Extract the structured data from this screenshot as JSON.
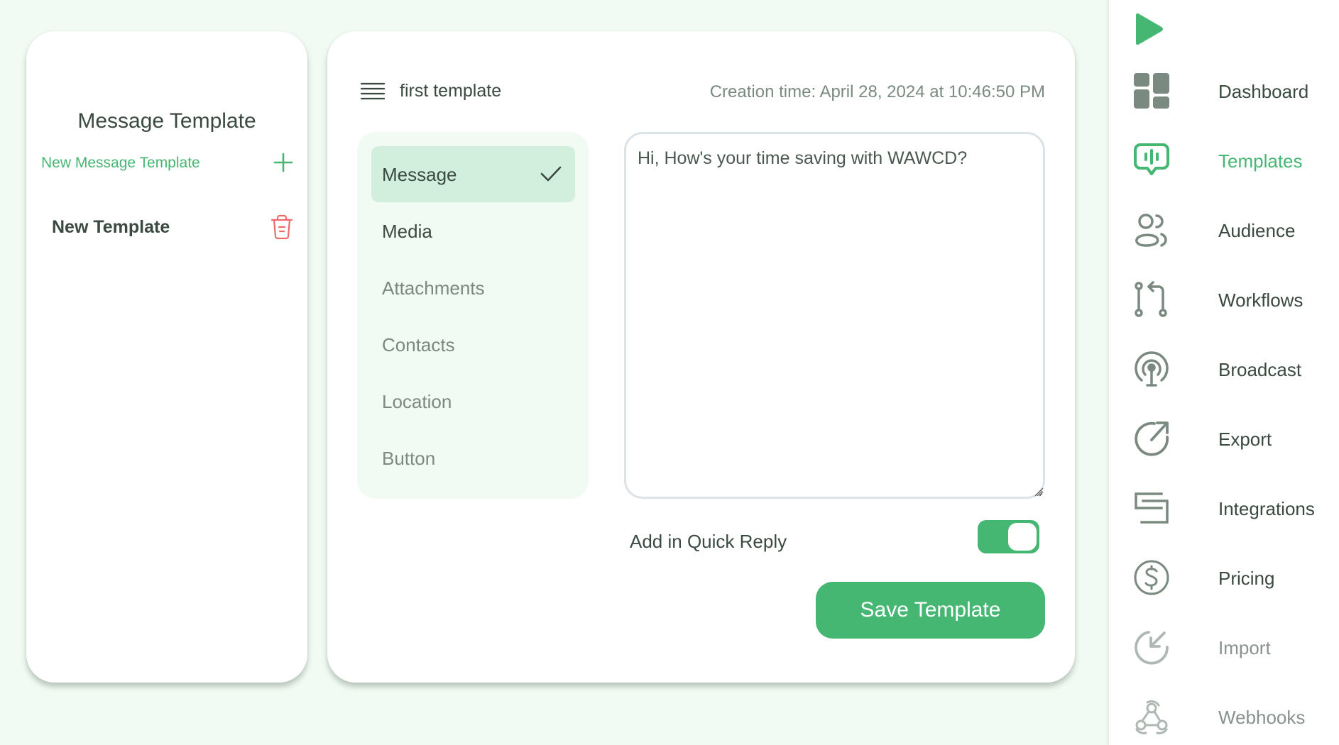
{
  "colors": {
    "accent": "#45b773",
    "background": "#f1fbf3",
    "text": "#3b4a40",
    "muted": "#7b8a80",
    "danger": "#f06a6a",
    "selected_tab": "#d2eedd",
    "icon_gray": "#7b8a80"
  },
  "left_panel": {
    "title": "Message Template",
    "new_template_label": "New Message Template",
    "templates": [
      {
        "name": "New Template"
      }
    ]
  },
  "editor": {
    "template_name": "first template",
    "creation_time": "Creation time: April 28, 2024 at 10:46:50 PM",
    "tabs": [
      {
        "label": "Message",
        "active": true
      },
      {
        "label": "Media",
        "active": false
      },
      {
        "label": "Attachments",
        "active": false
      },
      {
        "label": "Contacts",
        "active": false
      },
      {
        "label": "Location",
        "active": false
      },
      {
        "label": "Button",
        "active": false
      }
    ],
    "message_text": "Hi, How's your time saving with WAWCD?",
    "quick_reply_label": "Add in Quick Reply",
    "quick_reply_enabled": true,
    "save_button_label": "Save Template"
  },
  "sidebar": {
    "logo_icon": "play-logo-icon",
    "items": [
      {
        "label": "Dashboard",
        "icon": "dashboard-grid-icon",
        "active": false
      },
      {
        "label": "Templates",
        "icon": "message-bars-icon",
        "active": true
      },
      {
        "label": "Audience",
        "icon": "users-icon",
        "active": false
      },
      {
        "label": "Workflows",
        "icon": "git-pull-request-icon",
        "active": false
      },
      {
        "label": "Broadcast",
        "icon": "broadcast-antenna-icon",
        "active": false
      },
      {
        "label": "Export",
        "icon": "export-arrow-icon",
        "active": false
      },
      {
        "label": "Integrations",
        "icon": "integrations-icon",
        "active": false
      },
      {
        "label": "Pricing",
        "icon": "dollar-circle-icon",
        "active": false
      },
      {
        "label": "Import",
        "icon": "import-arrow-icon",
        "active": false,
        "faded": true
      },
      {
        "label": "Webhooks",
        "icon": "webhook-icon",
        "active": false,
        "faded": true
      }
    ]
  }
}
